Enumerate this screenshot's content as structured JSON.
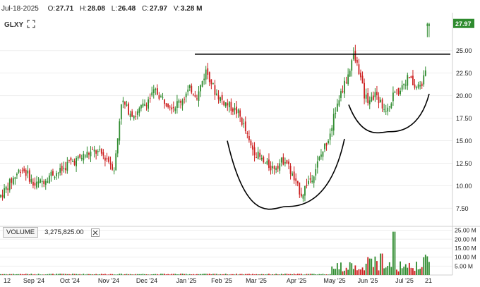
{
  "header": {
    "date": "Jul-18-2025",
    "open_label": "O:",
    "open": "27.71",
    "high_label": "H:",
    "high": "28.08",
    "low_label": "L:",
    "low": "26.48",
    "close_label": "C:",
    "close": "27.97",
    "volume_label": "V:",
    "volume": "3.28 M"
  },
  "symbol": "GLXY",
  "volume_pane": {
    "label": "VOLUME",
    "value": "3,275,825.00"
  },
  "last_price_tag": "27.97",
  "colors": {
    "up": "#2e8b2e",
    "down": "#cc1f1f",
    "tag_bg": "#2e8b2e",
    "grid": "#eeeeee",
    "line": "#000000"
  },
  "icons": [
    "expand-icon",
    "close-icon"
  ],
  "chart_data": {
    "type": "candlestick",
    "x_labels": [
      "12",
      "Sep '24",
      "Oct '24",
      "Nov '24",
      "Dec '24",
      "Jan '25",
      "Feb '25",
      "Mar '25",
      "Apr '25",
      "May '25",
      "Jun '25",
      "Jul '25",
      "21"
    ],
    "y_ticks": [
      "25.00",
      "22.50",
      "20.00",
      "17.50",
      "15.00",
      "12.50",
      "10.00",
      "7.50"
    ],
    "ylim": [
      5.5,
      29.2
    ],
    "volume_ticks": [
      "25.00 M",
      "20.00 M",
      "15.00 M",
      "10.00 M",
      "5.00 M"
    ],
    "volume_ylim": [
      0,
      27.2
    ],
    "resistance_level": 24.6,
    "price_path": [
      [
        0,
        8.8
      ],
      [
        14,
        10.3
      ],
      [
        30,
        12.0
      ],
      [
        40,
        11.2
      ],
      [
        48,
        10.0
      ],
      [
        60,
        10.5
      ],
      [
        72,
        11.3
      ],
      [
        86,
        11.6
      ],
      [
        98,
        12.6
      ],
      [
        110,
        12.9
      ],
      [
        122,
        13.5
      ],
      [
        134,
        13.8
      ],
      [
        144,
        13.5
      ],
      [
        154,
        12.8
      ],
      [
        162,
        11.9
      ],
      [
        166,
        14.7
      ],
      [
        172,
        19.5
      ],
      [
        180,
        18.5
      ],
      [
        192,
        17.8
      ],
      [
        206,
        19.2
      ],
      [
        220,
        20.5
      ],
      [
        232,
        19.5
      ],
      [
        246,
        18.8
      ],
      [
        258,
        19.6
      ],
      [
        270,
        20.8
      ],
      [
        280,
        20.0
      ],
      [
        286,
        21.5
      ],
      [
        292,
        22.8
      ],
      [
        298,
        21.8
      ],
      [
        304,
        20.5
      ],
      [
        314,
        19.5
      ],
      [
        326,
        18.8
      ],
      [
        338,
        18.0
      ],
      [
        346,
        16.5
      ],
      [
        354,
        14.5
      ],
      [
        364,
        13.5
      ],
      [
        374,
        12.5
      ],
      [
        386,
        12.0
      ],
      [
        396,
        12.5
      ],
      [
        404,
        13.0
      ],
      [
        412,
        11.5
      ],
      [
        420,
        10.0
      ],
      [
        428,
        9.0
      ],
      [
        434,
        10.2
      ],
      [
        442,
        11.0
      ],
      [
        450,
        12.5
      ],
      [
        458,
        14.0
      ],
      [
        466,
        15.5
      ],
      [
        474,
        18.0
      ],
      [
        484,
        20.5
      ],
      [
        494,
        22.5
      ],
      [
        500,
        24.5
      ],
      [
        508,
        23.0
      ],
      [
        516,
        20.0
      ],
      [
        524,
        19.5
      ],
      [
        532,
        20.3
      ],
      [
        540,
        19.0
      ],
      [
        548,
        18.7
      ],
      [
        556,
        19.8
      ],
      [
        564,
        20.5
      ],
      [
        572,
        21.5
      ],
      [
        580,
        22.0
      ],
      [
        588,
        20.8
      ],
      [
        596,
        21.2
      ],
      [
        602,
        22.0
      ],
      [
        605,
        25.5
      ],
      [
        608,
        27.97
      ]
    ],
    "cup_curves": [
      {
        "from_x": 322,
        "to_x": 488,
        "rim_price_left": 15.0,
        "rim_price_right": 15.2,
        "bottom_price": 7.7
      },
      {
        "from_x": 494,
        "to_x": 608,
        "rim_price_left": 19.0,
        "rim_price_right": 20.2,
        "bottom_price": 16.0
      }
    ]
  }
}
